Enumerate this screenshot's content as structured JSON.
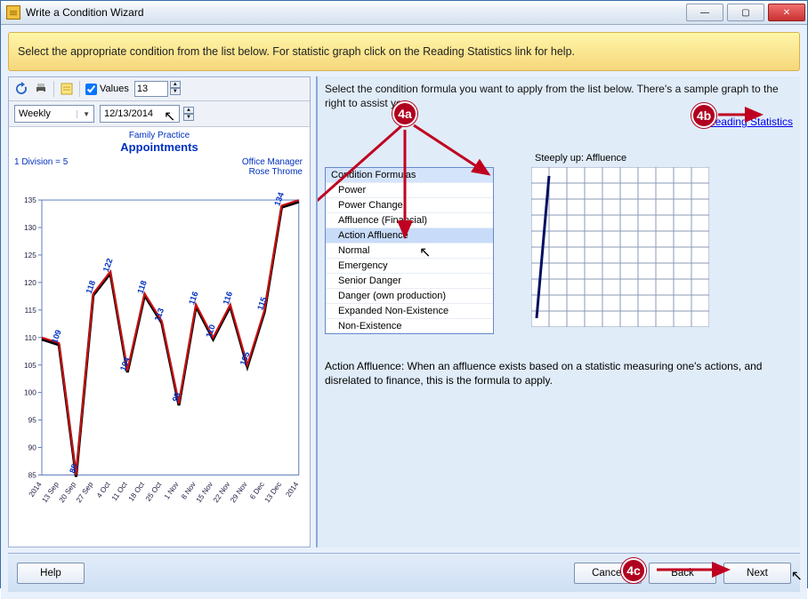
{
  "window": {
    "title": "Write a Condition Wizard"
  },
  "banner": "Select the appropriate condition from the list below. For statistic graph click on the Reading Statistics link for help.",
  "left": {
    "values_label": "Values",
    "values_checked": true,
    "values_count": "13",
    "period": "Weekly",
    "date": "12/13/2014",
    "chart_header_top": "Family Practice",
    "chart_header_main": "Appointments",
    "division_text": "1 Division = 5",
    "owner_role": "Office Manager",
    "owner_name": "Rose Throme"
  },
  "right": {
    "instruction": "Select the condition formula you want to apply from the list below. There's a sample graph to the right to assist you.",
    "reading_link": "Reading Statistics",
    "list_header": "Condition Formulas",
    "items": [
      {
        "label": "Power"
      },
      {
        "label": "Power Change"
      },
      {
        "label": "Affluence (Financial)"
      },
      {
        "label": "Action Affluence"
      },
      {
        "label": "Normal"
      },
      {
        "label": "Emergency"
      },
      {
        "label": "Senior Danger"
      },
      {
        "label": "Danger (own production)"
      },
      {
        "label": "Expanded Non-Existence"
      },
      {
        "label": "Non-Existence"
      }
    ],
    "selected_index": 3,
    "sample_title": "Steeply up: Affluence",
    "description": "Action Affluence: When an affluence exists based on a statistic measuring one's actions, and disrelated to finance, this is the formula to apply."
  },
  "footer": {
    "help": "Help",
    "cancel": "Cancel",
    "back": "Back",
    "next": "Next"
  },
  "annotations": {
    "a4a": "4a",
    "a4b": "4b",
    "a4c": "4c"
  },
  "chart_data": {
    "type": "line",
    "title": "Appointments",
    "xlabel": "",
    "ylabel": "",
    "ylim": [
      85,
      135
    ],
    "categories": [
      "2014",
      "13 Sep",
      "20 Sep",
      "27 Sep",
      "4 Oct",
      "11 Oct",
      "18 Oct",
      "25 Oct",
      "1 Nov",
      "8 Nov",
      "15 Nov",
      "22 Nov",
      "29 Nov",
      "6 Dec",
      "13 Dec",
      "2014"
    ],
    "values": [
      110,
      109,
      85,
      118,
      122,
      104,
      118,
      113,
      98,
      116,
      110,
      116,
      105,
      115,
      134,
      135
    ],
    "annotations_on_points": [
      null,
      "109",
      "85",
      "118",
      "122",
      "104",
      "118",
      "113",
      "98",
      "116",
      "110",
      "116",
      "105",
      "115",
      "134",
      null
    ],
    "secondary_series": {
      "name": "highlight",
      "color": "red"
    }
  },
  "sample_chart_data": {
    "type": "line",
    "title": "Steeply up: Affluence",
    "x": [
      0,
      1
    ],
    "y": [
      0.1,
      0.95
    ],
    "ylim": [
      0,
      1
    ]
  }
}
